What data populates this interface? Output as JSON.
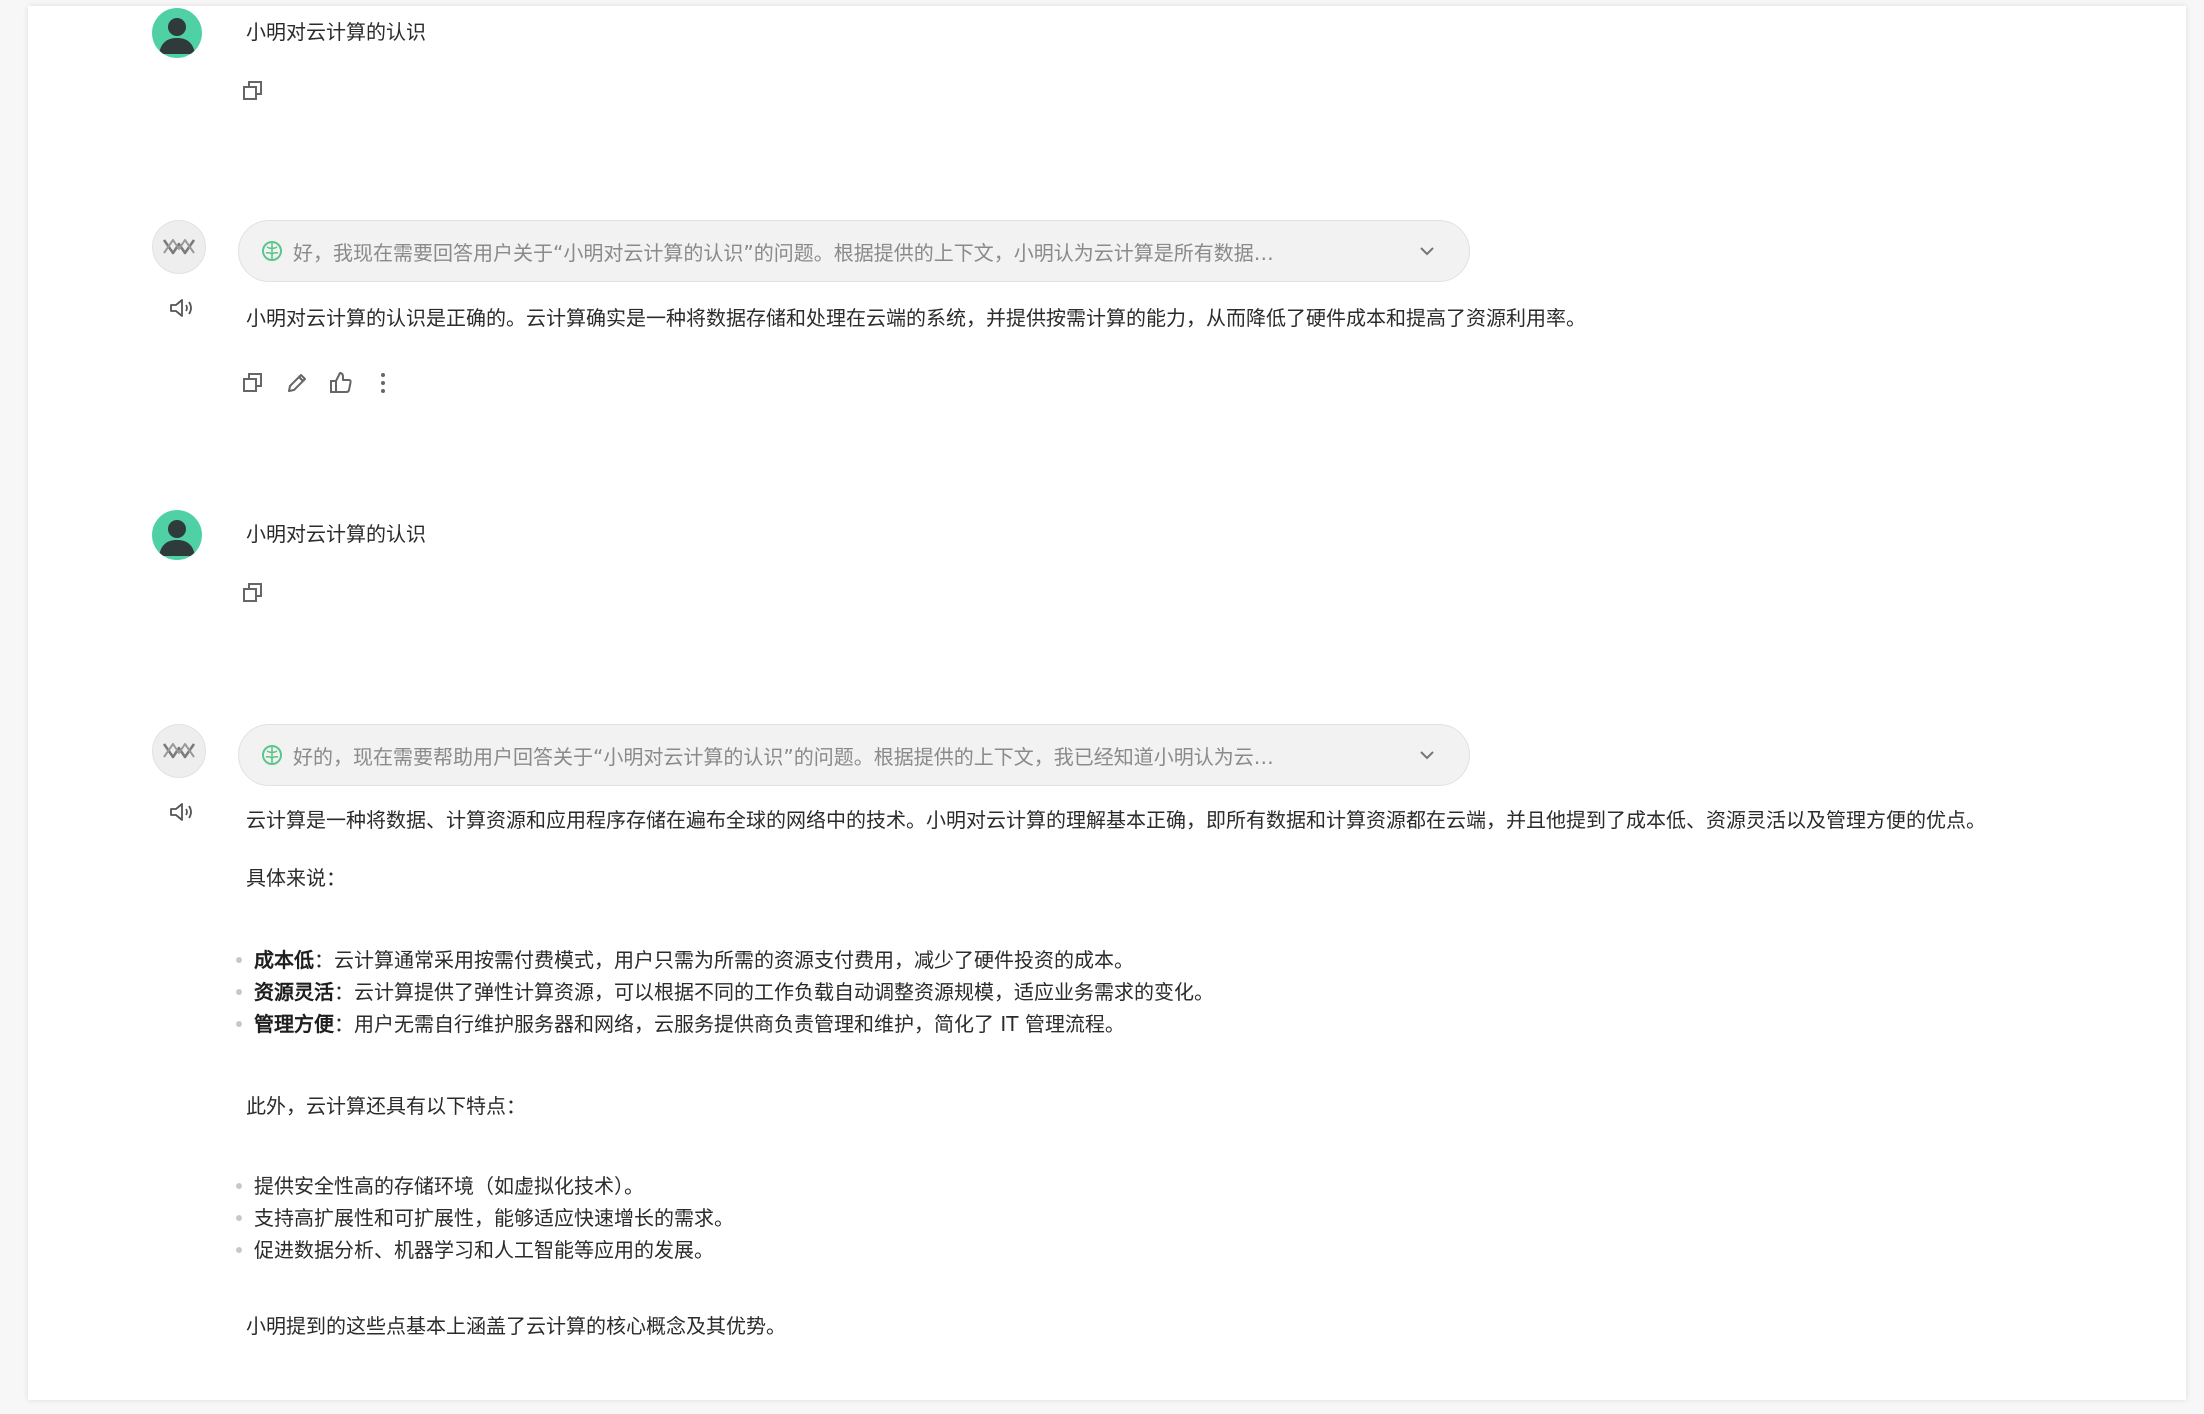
{
  "messages": [
    {
      "role": "user",
      "text": "小明对云计算的认识",
      "icon": "copy-icon"
    },
    {
      "role": "assistant",
      "thinking": "好，我现在需要回答用户关于“小明对云计算的认识”的问题。根据提供的上下文，小明认为云计算是所有数据…",
      "text": "小明对云计算的认识是正确的。云计算确实是一种将数据存储和处理在云端的系统，并提供按需计算的能力，从而降低了硬件成本和提高了资源利用率。",
      "actions": [
        "copy-icon",
        "edit-icon",
        "thumbs-up-icon",
        "more-icon"
      ]
    },
    {
      "role": "user",
      "text": "小明对云计算的认识",
      "icon": "copy-icon"
    },
    {
      "role": "assistant",
      "thinking": "好的，现在需要帮助用户回答关于“小明对云计算的认识”的问题。根据提供的上下文，我已经知道小明认为云…",
      "intro": "云计算是一种将数据、计算资源和应用程序存储在遍布全球的网络中的技术。小明对云计算的理解基本正确，即所有数据和计算资源都在云端，并且他提到了成本低、资源灵活以及管理方便的优点。",
      "specifically": "具体来说：",
      "points": [
        {
          "title": "成本低",
          "text": "：云计算通常采用按需付费模式，用户只需为所需的资源支付费用，减少了硬件投资的成本。"
        },
        {
          "title": "资源灵活",
          "text": "：云计算提供了弹性计算资源，可以根据不同的工作负载自动调整资源规模，适应业务需求的变化。"
        },
        {
          "title": "管理方便",
          "text": "：用户无需自行维护服务器和网络，云服务提供商负责管理和维护，简化了 IT 管理流程。"
        }
      ],
      "additionally": "此外，云计算还具有以下特点：",
      "features": [
        "提供安全性高的存储环境（如虚拟化技术）。",
        "支持高扩展性和可扩展性，能够适应快速增长的需求。",
        "促进数据分析、机器学习和人工智能等应用的发展。"
      ],
      "conclusion": "小明提到的这些点基本上涵盖了云计算的核心概念及其优势。"
    }
  ],
  "colors": {
    "user_avatar": "#4fd1a5",
    "think_icon": "#5cc58a"
  }
}
